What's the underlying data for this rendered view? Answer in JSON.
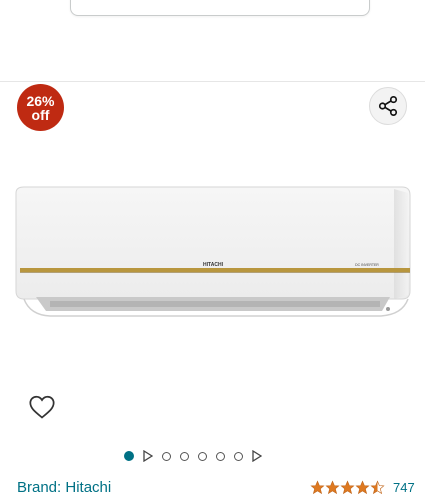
{
  "badge": {
    "percent": "26%",
    "off": "off"
  },
  "product": {
    "brand_text": "Brand: Hitachi"
  },
  "unit_labels": {
    "logo": "HITACHI",
    "tag": "DC INVERTER"
  },
  "rating": {
    "stars": 4.5,
    "count": "747"
  },
  "carousel": {
    "total": 8,
    "active_index": 0
  },
  "colors": {
    "badge": "#bf2a12",
    "link": "#007185",
    "star": "#de7921"
  },
  "icons": [
    "share-icon",
    "heart-icon",
    "play-icon",
    "star-icon"
  ]
}
